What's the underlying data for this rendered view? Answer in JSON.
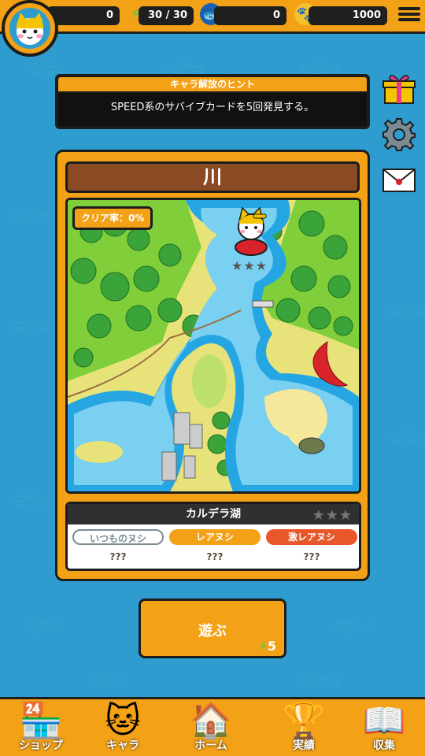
{
  "topbar": {
    "stat_1": "0",
    "energy": "30 / 30",
    "stat_2": "0",
    "coins": "1000"
  },
  "hint": {
    "title": "キャラ解放のヒント",
    "text": "SPEED系のサバイブカードを5回発見する。"
  },
  "stage": {
    "name": "川",
    "clear_rate": "クリア率：0%",
    "location": "カルデラ湖",
    "stars": "★★★"
  },
  "rarities": [
    {
      "label": "いつものヌシ",
      "value": "???"
    },
    {
      "label": "レアヌシ",
      "value": "???"
    },
    {
      "label": "激レアヌシ",
      "value": "???"
    }
  ],
  "play": {
    "label": "遊ぶ",
    "cost": "5"
  },
  "nav": {
    "shop": "ショップ",
    "chara": "キャラ",
    "home": "ホーム",
    "achievements": "実績",
    "collection": "収集"
  },
  "colors": {
    "accent": "#f3a116",
    "background": "#2f9ccf",
    "dark": "#1d1d1d"
  }
}
